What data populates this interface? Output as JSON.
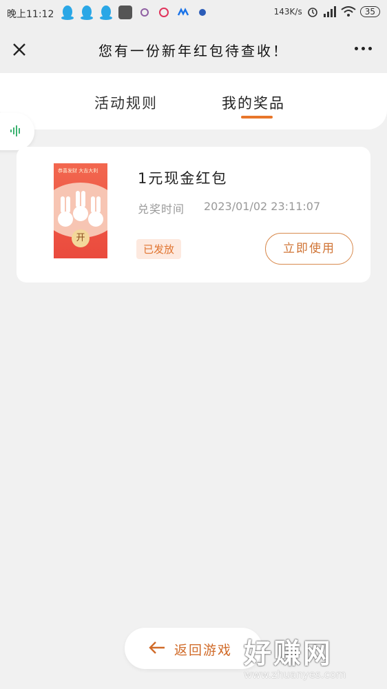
{
  "status_bar": {
    "time": "晚上11:12",
    "net_speed": "143K/s",
    "battery": "35"
  },
  "header": {
    "title": "您有一份新年红包待查收！"
  },
  "tabs": [
    {
      "label": "活动规则",
      "active": false
    },
    {
      "label": "我的奖品",
      "active": true
    }
  ],
  "prize": {
    "name": "1元现金红包",
    "time_label": "兑奖时间",
    "time_value": "2023/01/02 23:11:07",
    "status": "已发放",
    "use_button": "立即使用",
    "thumb_text": "恭喜发财 大吉大利",
    "thumb_open": "开"
  },
  "return_button": "返回游戏",
  "watermark": {
    "text": "好赚网",
    "url": "www.zhuanyes.com"
  },
  "colors": {
    "accent": "#e8762a",
    "background": "#f1f1f1",
    "card": "#ffffff",
    "voice_icon": "#3cb371"
  }
}
